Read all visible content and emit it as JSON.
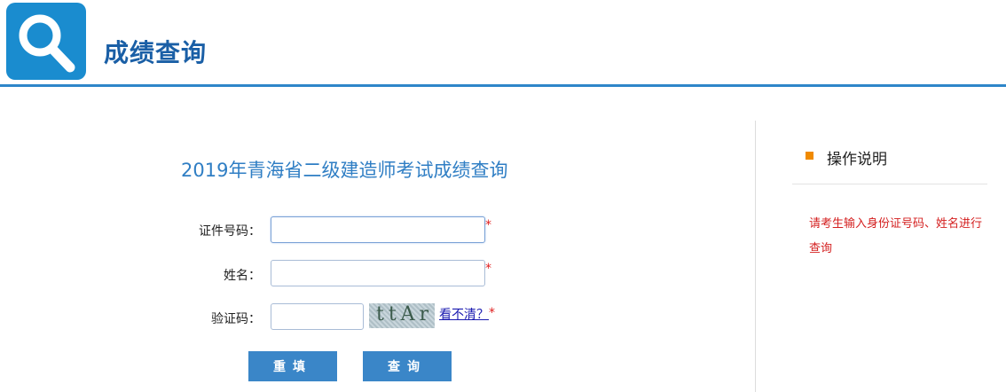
{
  "header": {
    "logo_icon": "search-icon",
    "title": "成绩查询",
    "accent_color": "#2e86c9"
  },
  "form": {
    "title": "2019年青海省二级建造师考试成绩查询",
    "id_label": "证件号码：",
    "id_value": "",
    "name_label": "姓名：",
    "name_value": "",
    "captcha_label": "验证码：",
    "captcha_value": "",
    "captcha_text": "ttAr",
    "refresh_link": "看不清？",
    "required_mark": "*",
    "reset_button": "重填",
    "query_button": "查询"
  },
  "side": {
    "title": "操作说明",
    "note": "请考生输入身份证号码、姓名进行查询"
  }
}
